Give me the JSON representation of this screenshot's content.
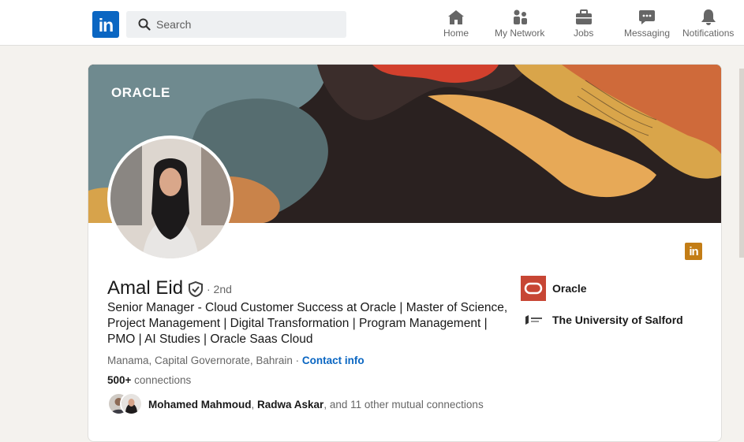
{
  "topbar": {
    "logo_text": "in",
    "search_placeholder": "Search",
    "nav": [
      {
        "label": "Home",
        "icon": "home-icon"
      },
      {
        "label": "My Network",
        "icon": "network-icon"
      },
      {
        "label": "Jobs",
        "icon": "briefcase-icon"
      },
      {
        "label": "Messaging",
        "icon": "messaging-icon"
      },
      {
        "label": "Notifications",
        "icon": "bell-icon"
      }
    ]
  },
  "profile": {
    "banner_brand": "ORACLE",
    "name": "Amal Eid",
    "degree": "· 2nd",
    "headline": "Senior Manager - Cloud Customer Success at Oracle | Master of Science, Project Management | Digital Transformation | Program Management | PMO | AI Studies | Oracle Saas Cloud",
    "location": "Manama, Capital Governorate, Bahrain",
    "location_sep": " · ",
    "contact_info": "Contact info",
    "connections_count": "500+",
    "connections_label": " connections",
    "mutual_name_1": "Mohamed Mahmoud",
    "mutual_sep": ", ",
    "mutual_name_2": "Radwa Askar",
    "mutual_rest": ", and 11 other mutual connections",
    "linkedin_badge": "in"
  },
  "experience": [
    {
      "name": "Oracle"
    },
    {
      "name": "The University of Salford"
    }
  ],
  "colors": {
    "brand_blue": "#0a66c2",
    "oracle_red": "#c74634",
    "premium_gold": "#c37d16"
  }
}
